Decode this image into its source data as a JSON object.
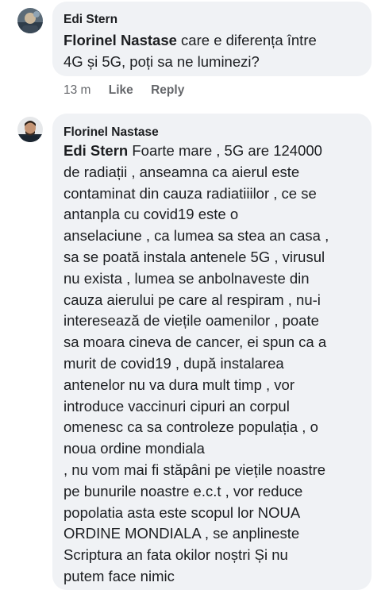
{
  "comment1": {
    "author": "Edi Stern",
    "mention": "Florinel Nastase",
    "text_line1_rest": " care e diferența între",
    "text_line2": "4G și 5G, poți sa ne luminezi?",
    "time": "13 m",
    "like_label": "Like",
    "reply_label": "Reply",
    "avatar_icon": "profile-photo"
  },
  "comment2": {
    "author": "Florinel Nastase",
    "mention": "Edi Stern",
    "avatar_icon": "profile-photo",
    "first_line_rest": " Foarte mare , 5G are 124000",
    "lines": [
      "de radiații , anseamna ca aierul este",
      "contaminat din cauza radiatiiilor , ce se",
      "antanpla cu covid19 este o",
      "anselaciune , ca lumea sa stea an casa ,",
      "sa se poată instala antenele 5G , virusul",
      "nu exista , lumea se anbolnaveste din",
      "cauza aierului pe care al respiram , nu-i",
      "interesează de viețile oamenilor , poate",
      "sa moara cineva de cancer, ei spun ca a",
      "murit de covid19 , după instalarea",
      "antenelor nu va dura mult timp , vor",
      "introduce vaccinuri cipuri an corpul",
      "omenesc ca sa controleze populația , o",
      "noua ordine mondiala",
      ", nu vom mai fi stăpâni pe viețile noastre",
      "pe bunurile noastre e.c.t , vor reduce",
      "popolatia asta este scopul lor NOUA",
      "ORDINE MONDIALA , se anplineste",
      "Scriptura an fata okilor noștri  Și nu",
      "putem face nimic"
    ]
  }
}
